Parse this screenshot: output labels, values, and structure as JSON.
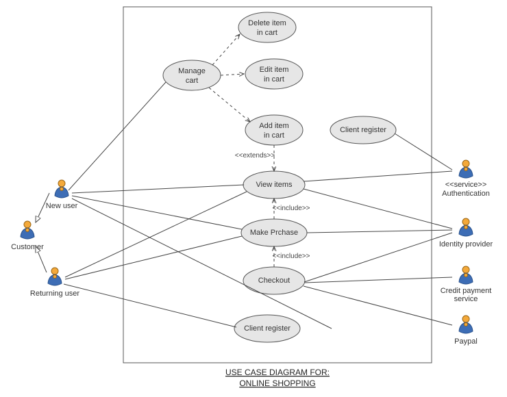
{
  "title_line1": "USE CASE DIAAGRAM FOR:",
  "title_line1_correct": "USE CASE DIAGRAM FOR:",
  "title_line2": "ONLINE SHOPPING",
  "stereotypes": {
    "extends": "<<extends>>",
    "include": "<<include>>",
    "service": "<<service>>"
  },
  "actors": {
    "customer": "Customer",
    "new_user": "New user",
    "returning_user": "Returning user",
    "authentication": "Authentication",
    "identity_provider": "Identity provider",
    "credit_payment": "Credit payment",
    "credit_payment_line2": "service",
    "paypal": "Paypal"
  },
  "usecases": {
    "manage_cart": {
      "l1": "Manage",
      "l2": "cart"
    },
    "delete_item": {
      "l1": "Delete item",
      "l2": "in cart"
    },
    "edit_item": {
      "l1": "Edit item",
      "l2": "in cart"
    },
    "add_item": {
      "l1": "Add item",
      "l2": "in cart"
    },
    "view_items": {
      "l1": "View items"
    },
    "make_purchase": {
      "l1": "Make Prchase"
    },
    "checkout": {
      "l1": "Checkout"
    },
    "client_register_top": {
      "l1": "Client register"
    },
    "client_register_bottom": {
      "l1": "Client register"
    }
  }
}
